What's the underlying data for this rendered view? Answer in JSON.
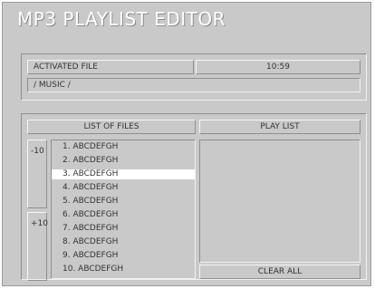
{
  "app": {
    "title": "MP3 PLAYLIST EDITOR"
  },
  "activated_file": {
    "label": "ACTIVATED FILE",
    "time": "10:59",
    "path": "/ MUSIC /"
  },
  "list_of_files": {
    "header": "LIST OF FILES",
    "page_up": "-10",
    "page_down": "+10",
    "selected_index": 2,
    "items": [
      "1. ABCDEFGH",
      "2. ABCDEFGH",
      "3. ABCDEFGH",
      "4. ABCDEFGH",
      "5. ABCDEFGH",
      "6. ABCDEFGH",
      "7. ABCDEFGH",
      "8. ABCDEFGH",
      "9. ABCDEFGH",
      "10. ABCDEFGH"
    ]
  },
  "play_list": {
    "header": "PLAY LIST",
    "clear_label": "CLEAR ALL"
  },
  "colors": {
    "background": "#c9c9c9",
    "highlight": "#ffffff",
    "text": "#333333"
  }
}
